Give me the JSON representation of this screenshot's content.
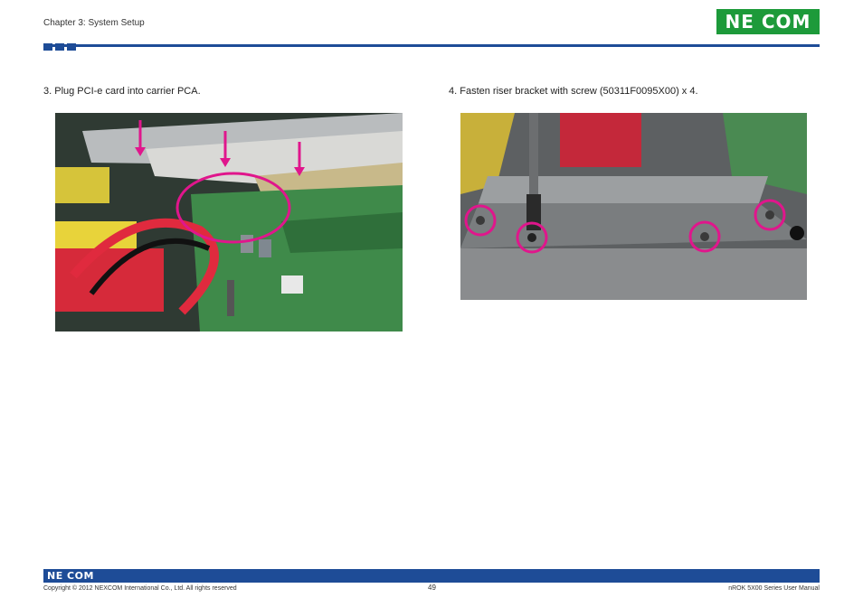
{
  "header": {
    "chapter": "Chapter 3: System Setup",
    "logo_text": "NE COM"
  },
  "steps": [
    {
      "text": "3.  Plug PCI-e card into carrier PCA."
    },
    {
      "text": "4.  Fasten riser bracket with screw (50311F0095X00) x 4."
    }
  ],
  "footer": {
    "logo_text": "NE COM",
    "copyright": "Copyright © 2012 NEXCOM International Co., Ltd. All rights reserved",
    "page_number": "49",
    "manual_name": "nROK 5X00 Series User Manual"
  },
  "colors": {
    "brand_blue": "#1e4c97",
    "logo_green": "#1d9a3a",
    "annotation_magenta": "#e0168c"
  }
}
